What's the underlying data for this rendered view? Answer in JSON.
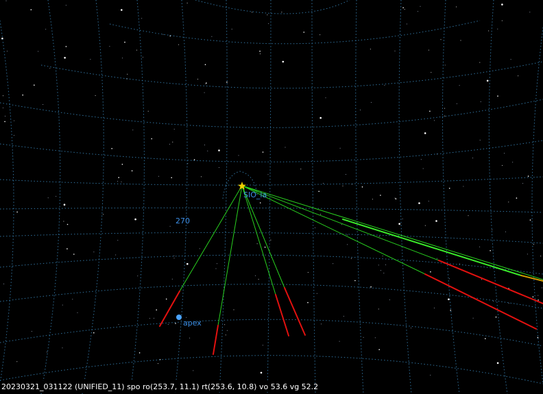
{
  "colors": {
    "background": "#000000",
    "grid": "#2f6f9a",
    "radiant": "#f2d200",
    "trail_green": "#29d11f",
    "trail_red": "#e3110f",
    "trail_orange": "#d6a000",
    "label_blue": "#3c8fe6",
    "apex_marker": "#4aa3ff",
    "status_text": "#ffffff",
    "status_bg": "#000000"
  },
  "labels": {
    "radiant": "SIO_ia",
    "azimuth": "270",
    "apex": "apex"
  },
  "markers": {
    "radiant_icon": "star-icon",
    "apex_icon": "dot-icon"
  },
  "status": {
    "text": "20230321_031122 (UNIFIED_11) spo ro(253.7, 11.1) rt(253.6, 10.8) vo 53.6 vg 52.2"
  }
}
